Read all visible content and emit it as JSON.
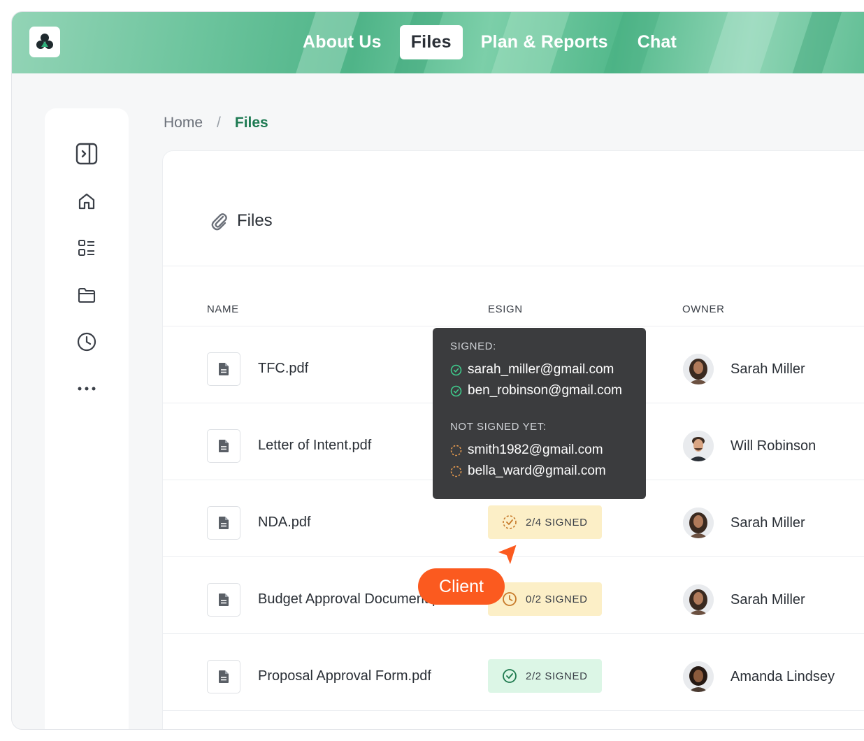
{
  "nav": {
    "items": [
      {
        "label": "About Us",
        "active": false
      },
      {
        "label": "Files",
        "active": true
      },
      {
        "label": "Plan & Reports",
        "active": false
      },
      {
        "label": "Chat",
        "active": false
      }
    ]
  },
  "sidebar": {
    "icons": [
      "collapse-panel-icon",
      "home-icon",
      "dashboard-list-icon",
      "folder-icon",
      "clock-icon",
      "more-icon"
    ]
  },
  "breadcrumb": {
    "home": "Home",
    "separator": "/",
    "current": "Files"
  },
  "card": {
    "title": "Files"
  },
  "table": {
    "headers": {
      "name": "NAME",
      "esign": "ESIGN",
      "owner": "OWNER"
    },
    "rows": [
      {
        "name": "TFC.pdf",
        "esign": "",
        "status": "",
        "owner": "Sarah Miller"
      },
      {
        "name": "Letter of Intent.pdf",
        "esign": "",
        "status": "",
        "owner": "Will Robinson"
      },
      {
        "name": "NDA.pdf",
        "esign": "2/4 SIGNED",
        "status": "pending",
        "owner": "Sarah Miller"
      },
      {
        "name": "Budget Approval Document.pdf",
        "esign": "0/2 SIGNED",
        "status": "pending",
        "owner": "Sarah Miller"
      },
      {
        "name": "Proposal Approval Form.pdf",
        "esign": "2/2 SIGNED",
        "status": "done",
        "owner": "Amanda Lindsey"
      }
    ]
  },
  "tooltip": {
    "signed_heading": "SIGNED:",
    "signed": [
      "sarah_miller@gmail.com",
      "ben_robinson@gmail.com"
    ],
    "not_signed_heading": "NOT SIGNED YET:",
    "not_signed": [
      "smith1982@gmail.com",
      "bella_ward@gmail.com"
    ]
  },
  "cursor_label": "Client",
  "colors": {
    "accent": "#1d7a52",
    "client": "#fb5a1f",
    "pending": "#fcefc7",
    "done": "#dcf6e6",
    "tooltip_bg": "#3b3c3e"
  }
}
